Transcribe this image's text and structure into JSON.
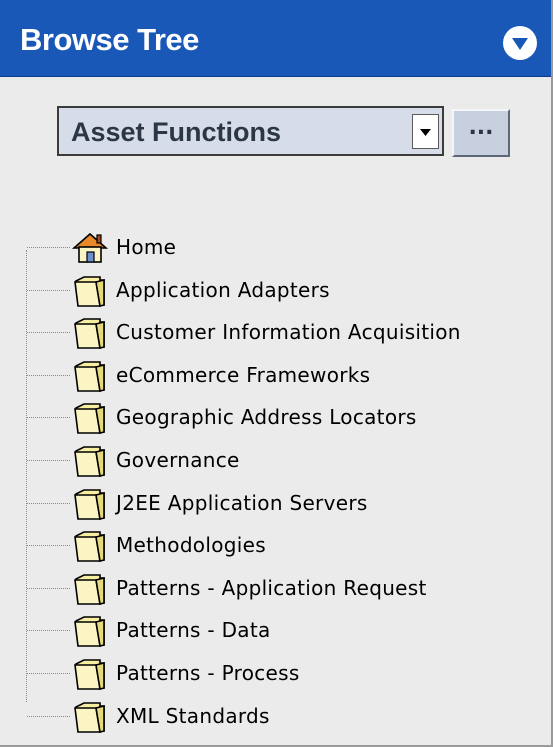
{
  "header": {
    "title": "Browse Tree",
    "collapse_icon": "chevron-down-circle-icon"
  },
  "selector": {
    "value": "Asset Functions",
    "more_label": "..."
  },
  "tree": {
    "items": [
      {
        "label": "Home",
        "icon": "home-icon"
      },
      {
        "label": "Application Adapters",
        "icon": "folder-icon"
      },
      {
        "label": "Customer Information Acquisition",
        "icon": "folder-icon"
      },
      {
        "label": "eCommerce Frameworks",
        "icon": "folder-icon"
      },
      {
        "label": "Geographic Address Locators",
        "icon": "folder-icon"
      },
      {
        "label": "Governance",
        "icon": "folder-icon"
      },
      {
        "label": "J2EE Application Servers",
        "icon": "folder-icon"
      },
      {
        "label": "Methodologies",
        "icon": "folder-icon"
      },
      {
        "label": "Patterns - Application Request",
        "icon": "folder-icon"
      },
      {
        "label": "Patterns - Data",
        "icon": "folder-icon"
      },
      {
        "label": "Patterns - Process",
        "icon": "folder-icon"
      },
      {
        "label": "XML Standards",
        "icon": "folder-icon"
      }
    ]
  },
  "colors": {
    "header_bg": "#1a58b8",
    "panel_bg": "#ebebeb",
    "folder_fill": "#f7eea2"
  }
}
